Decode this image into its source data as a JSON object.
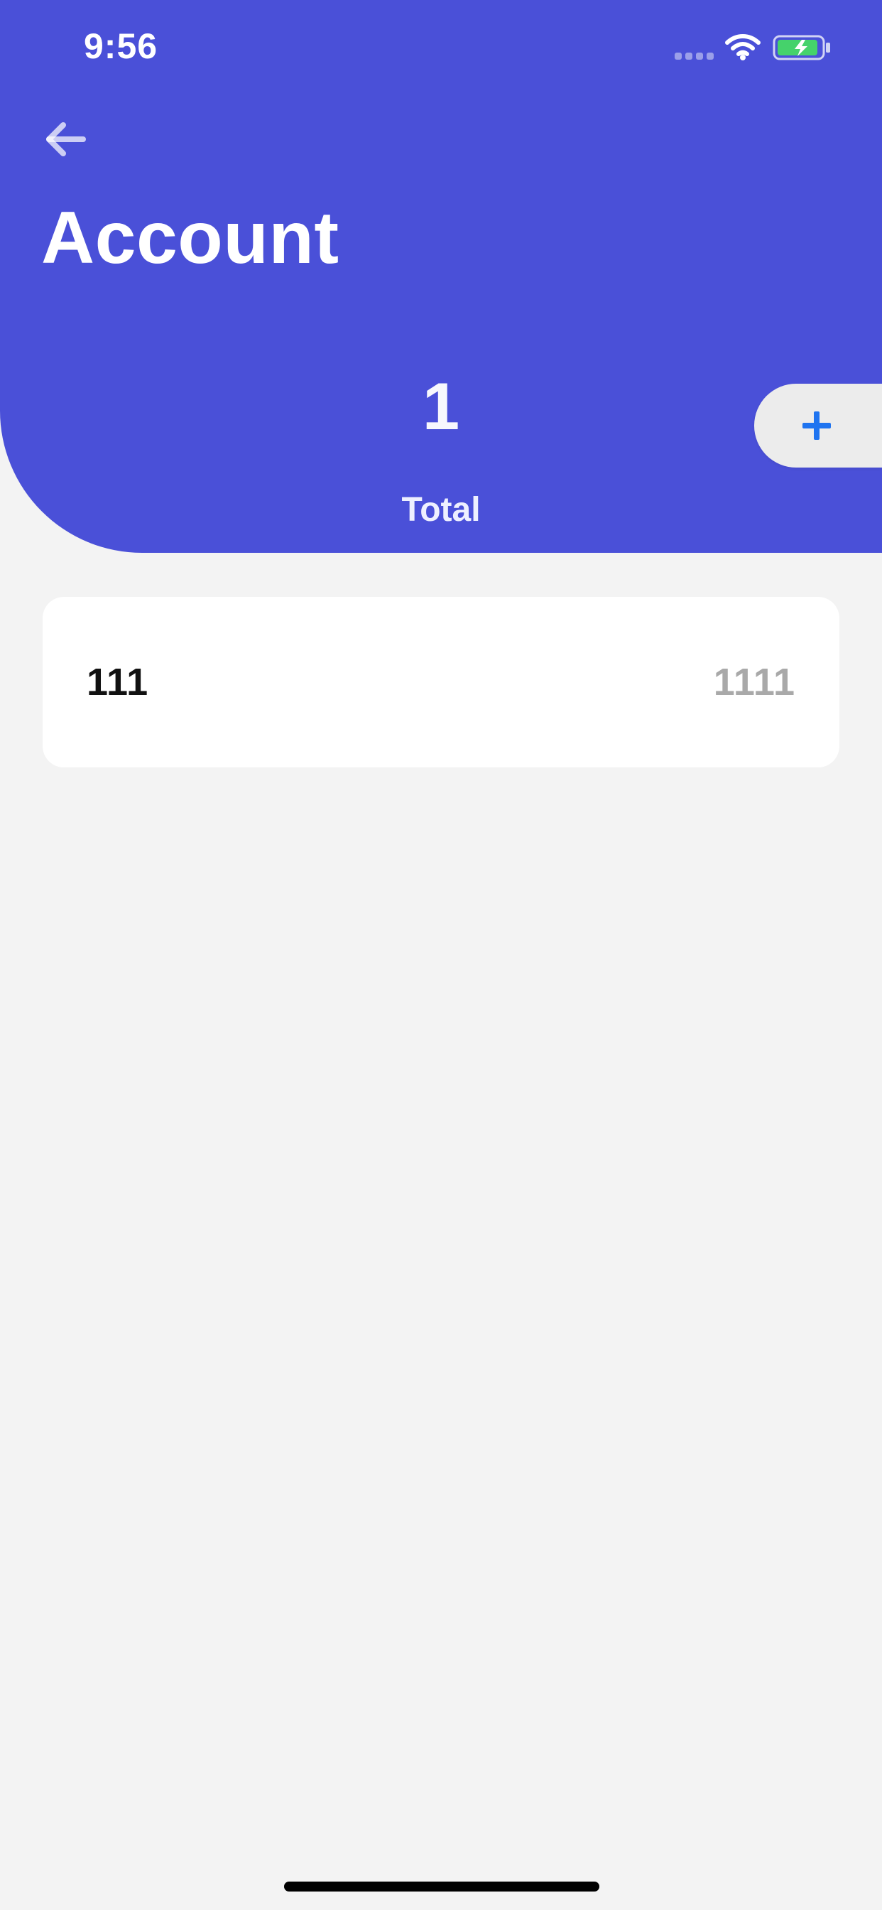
{
  "status_bar": {
    "time": "9:56"
  },
  "header": {
    "title": "Account",
    "total_value": "1",
    "total_label": "Total",
    "back_icon": "arrow-left-icon",
    "add_icon": "plus-icon"
  },
  "accounts": [
    {
      "name": "111",
      "value": "1111"
    }
  ],
  "colors": {
    "header_background": "#4a50d8",
    "page_background": "#f3f3f3",
    "accent": "#1f74f0",
    "card_background": "#ffffff",
    "secondary_text": "#a9a9a9",
    "battery_fill": "#45d26b"
  }
}
